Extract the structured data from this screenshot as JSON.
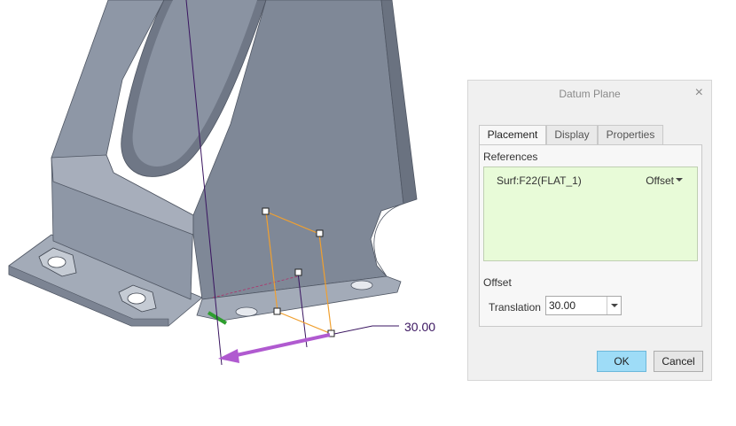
{
  "dimension": {
    "value": "30.00"
  },
  "dialog": {
    "title": "Datum Plane",
    "close_glyph": "×",
    "tabs": [
      {
        "label": "Placement",
        "active": true
      },
      {
        "label": "Display",
        "active": false
      },
      {
        "label": "Properties",
        "active": false
      }
    ],
    "references": {
      "label": "References",
      "items": [
        {
          "name": "Surf:F22(FLAT_1)",
          "constraint": "Offset"
        }
      ]
    },
    "offset": {
      "label": "Offset",
      "translation_label": "Translation",
      "translation_value": "30.00"
    },
    "buttons": {
      "ok": "OK",
      "cancel": "Cancel"
    }
  },
  "colors": {
    "part_face": "#8e97a6",
    "part_dark": "#6f7786",
    "part_light": "#b0b7c3",
    "datum_plane": "#f0a030",
    "drag_arrow": "#b05ad0",
    "edge_highlight": "#2e9e2e",
    "references_bg": "#e8fbd8",
    "ok_button": "#9edcf7"
  },
  "icons": {
    "close": "close-icon",
    "dropdown": "chevron-down-icon"
  }
}
